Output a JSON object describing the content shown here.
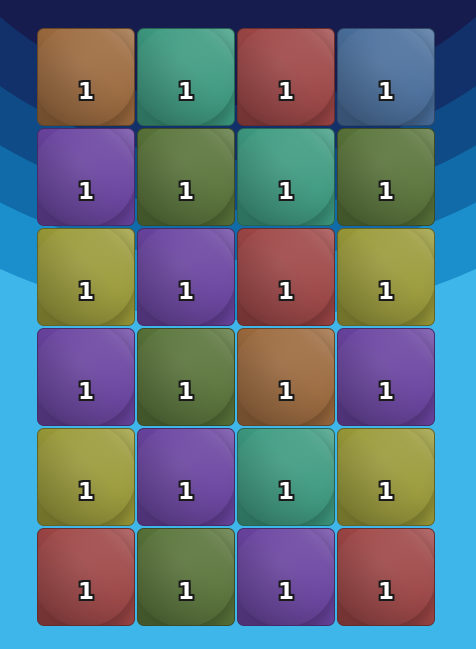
{
  "palette": {
    "orange": "#9c6a3e",
    "teal": "#3d9a80",
    "red": "#9e4646",
    "blue": "#4a6f9c",
    "purple": "#6a44a0",
    "green": "#59743a",
    "yellow": "#9a9a3a"
  },
  "background": {
    "bands": [
      "#161c4e",
      "#12306a",
      "#0f4b86",
      "#106ba8",
      "#1a8fcc",
      "#3fb6ea"
    ]
  },
  "board": {
    "rows": [
      [
        {
          "color": "orange",
          "value": "1"
        },
        {
          "color": "teal",
          "value": "1"
        },
        {
          "color": "red",
          "value": "1"
        },
        {
          "color": "blue",
          "value": "1"
        }
      ],
      [
        {
          "color": "purple",
          "value": "1"
        },
        {
          "color": "green",
          "value": "1"
        },
        {
          "color": "teal",
          "value": "1"
        },
        {
          "color": "green",
          "value": "1"
        }
      ],
      [
        {
          "color": "yellow",
          "value": "1"
        },
        {
          "color": "purple",
          "value": "1"
        },
        {
          "color": "red",
          "value": "1"
        },
        {
          "color": "yellow",
          "value": "1"
        }
      ],
      [
        {
          "color": "purple",
          "value": "1"
        },
        {
          "color": "green",
          "value": "1"
        },
        {
          "color": "orange",
          "value": "1"
        },
        {
          "color": "purple",
          "value": "1"
        }
      ],
      [
        {
          "color": "yellow",
          "value": "1"
        },
        {
          "color": "purple",
          "value": "1"
        },
        {
          "color": "teal",
          "value": "1"
        },
        {
          "color": "yellow",
          "value": "1"
        }
      ],
      [
        {
          "color": "red",
          "value": "1"
        },
        {
          "color": "green",
          "value": "1"
        },
        {
          "color": "purple",
          "value": "1"
        },
        {
          "color": "red",
          "value": "1"
        }
      ]
    ]
  }
}
